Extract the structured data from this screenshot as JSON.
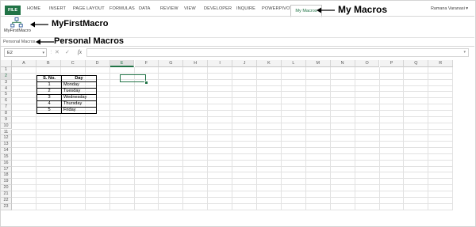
{
  "ribbon": {
    "tabs": [
      "HOME",
      "INSERT",
      "PAGE LAYOUT",
      "FORMULAS",
      "DATA",
      "REVIEW",
      "VIEW",
      "DEVELOPER",
      "INQUIRE",
      "POWERPIVOT"
    ],
    "file_tab": "FILE",
    "active_tab": "My Macros",
    "user_name": "Ramana Varanasi",
    "macro_button_label": "MyFirstMacro",
    "group_label": "Personal Macros"
  },
  "annotations": {
    "tab": "My Macros",
    "macro": "MyFirstMacro",
    "group": "Personal Macros"
  },
  "formula_bar": {
    "name_box": "E2",
    "fx": "fx",
    "value": ""
  },
  "sheet": {
    "columns": [
      "A",
      "B",
      "C",
      "D",
      "E",
      "F",
      "G",
      "H",
      "I",
      "J",
      "K",
      "L",
      "M",
      "N",
      "O",
      "P",
      "Q",
      "R"
    ],
    "rows": [
      "1",
      "2",
      "3",
      "4",
      "5",
      "6",
      "7",
      "8",
      "9",
      "10",
      "11",
      "12",
      "13",
      "14",
      "15",
      "16",
      "17",
      "18",
      "19",
      "20",
      "21",
      "22",
      "23"
    ],
    "selected_cell": "E2",
    "table": {
      "headers": [
        "S. No.",
        "Day"
      ],
      "rows": [
        [
          "1",
          "Monday"
        ],
        [
          "2",
          "Tuesday"
        ],
        [
          "3",
          "Wednesday"
        ],
        [
          "4",
          "Thursday"
        ],
        [
          "5",
          "Friday"
        ]
      ]
    }
  },
  "colors": {
    "accent": "#217346"
  }
}
